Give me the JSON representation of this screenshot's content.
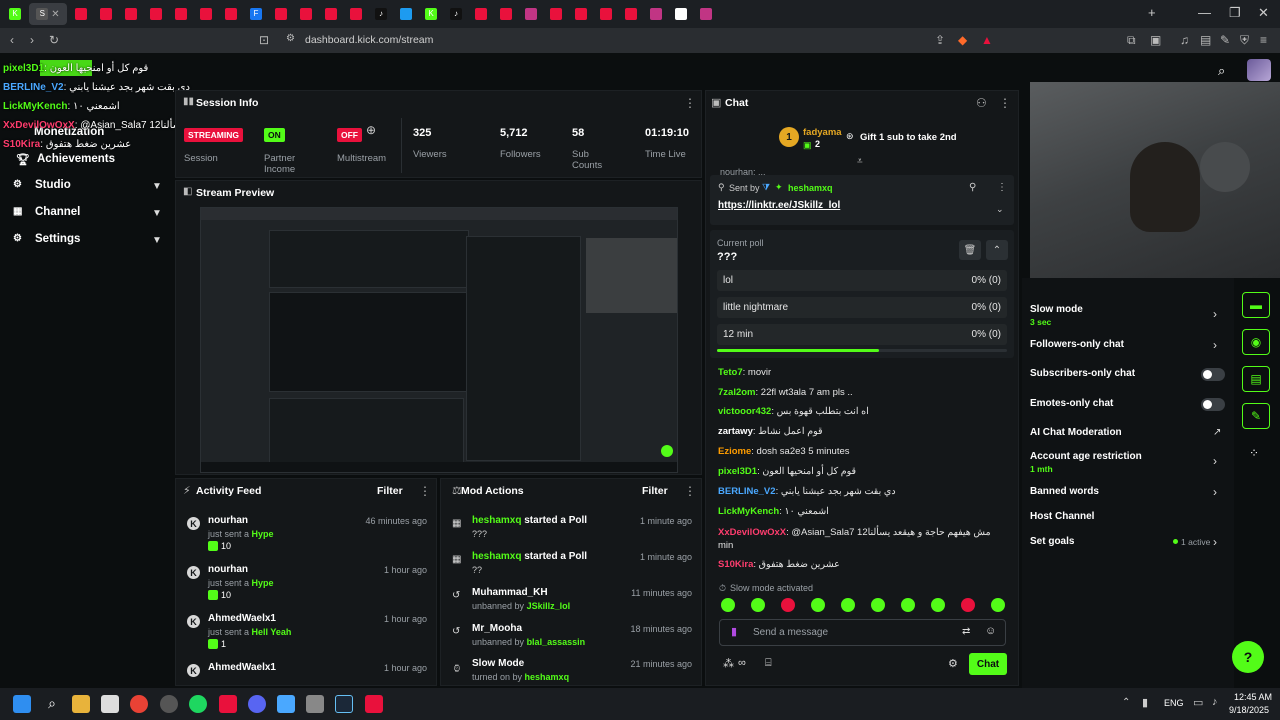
{
  "browser": {
    "url": "dashboard.kick.com/stream",
    "tabs": [
      {
        "fav": "#53fc18",
        "t": "K"
      },
      {
        "fav": "#e9113c",
        "t": ""
      },
      {
        "fav": "#e9113c",
        "t": ""
      },
      {
        "fav": "#e9113c",
        "t": ""
      },
      {
        "fav": "#e9113c",
        "t": ""
      },
      {
        "fav": "#e9113c",
        "t": ""
      },
      {
        "fav": "#e9113c",
        "t": ""
      },
      {
        "fav": "#e9113c",
        "t": ""
      },
      {
        "fav": "#e9113c",
        "t": ""
      },
      {
        "fav": "#1877f2",
        "t": "F"
      },
      {
        "fav": "#e9113c",
        "t": ""
      },
      {
        "fav": "#e9113c",
        "t": ""
      },
      {
        "fav": "#e9113c",
        "t": ""
      },
      {
        "fav": "#e9113c",
        "t": ""
      },
      {
        "fav": "#111",
        "t": "♪"
      },
      {
        "fav": "#1d9bf0",
        "t": ""
      },
      {
        "fav": "#53fc18",
        "t": "K"
      },
      {
        "fav": "#111",
        "t": "♪"
      },
      {
        "fav": "#e9113c",
        "t": ""
      },
      {
        "fav": "#e9113c",
        "t": ""
      },
      {
        "fav": "#c13584",
        "t": ""
      },
      {
        "fav": "#e9113c",
        "t": ""
      },
      {
        "fav": "#e9113c",
        "t": ""
      },
      {
        "fav": "#e9113c",
        "t": ""
      },
      {
        "fav": "#e9113c",
        "t": ""
      },
      {
        "fav": "#c13584",
        "t": ""
      },
      {
        "fav": "#fff",
        "t": "G"
      },
      {
        "fav": "#c13584",
        "t": ""
      }
    ],
    "selected_tab_letter": "S",
    "tab_letter_r": "r",
    "new_tab": "+",
    "minimize": "—",
    "maximize": "❐",
    "close": "✕"
  },
  "sidebar": {
    "items": [
      {
        "label": "Monetization"
      },
      {
        "label": "Achievements"
      },
      {
        "label": "Studio"
      },
      {
        "label": "Channel"
      },
      {
        "label": "Settings"
      }
    ]
  },
  "overlay_chat": [
    {
      "user": "pixel3D1",
      "text": "قوم كل أو امنحيها العون"
    },
    {
      "user": "BERLINe_V2",
      "text": "دي بقت شهر بجد عيشنا يابني"
    },
    {
      "user": "LickMyKench",
      "text": "اشمعني ١٠"
    },
    {
      "user": "XxDevilOwOxX",
      "text": "@Asian_Sala7 12مش هيفهم حاجة و هيقعد يسألنا min"
    },
    {
      "user": "S10Kira",
      "text": "عشرين ضغط هتفوق"
    }
  ],
  "session_info": {
    "title": "Session Info",
    "stats": [
      {
        "value": "STREAMING",
        "label": "Session"
      },
      {
        "value": "ON",
        "label": "Partner Income"
      },
      {
        "value": "OFF",
        "label": "Multistream"
      },
      {
        "value": "325",
        "label": "Viewers"
      },
      {
        "value": "5,712",
        "label": "Followers"
      },
      {
        "value": "58",
        "label": "Sub Counts"
      },
      {
        "value": "01:19:10",
        "label": "Time Live"
      }
    ]
  },
  "stream_preview": {
    "title": "Stream Preview"
  },
  "activity_feed": {
    "title": "Activity Feed",
    "filter": "Filter",
    "items": [
      {
        "name": "nourhan",
        "action": "just sent a",
        "gift": "Hype",
        "amount": "10",
        "time": "46 minutes ago"
      },
      {
        "name": "nourhan",
        "action": "just sent a",
        "gift": "Hype",
        "amount": "10",
        "time": "1 hour ago"
      },
      {
        "name": "AhmedWaelx1",
        "action": "just sent a",
        "gift": "Hell Yeah",
        "amount": "1",
        "time": "1 hour ago"
      },
      {
        "name": "AhmedWaelx1",
        "action": "",
        "gift": "",
        "amount": "",
        "time": "1 hour ago"
      }
    ]
  },
  "mod_actions": {
    "title": "Mod Actions",
    "filter": "Filter",
    "items": [
      {
        "name": "heshamxq",
        "action": "started a Poll",
        "detail": "???",
        "time": "1 minute ago"
      },
      {
        "name": "heshamxq",
        "action": "started a Poll",
        "detail": "??",
        "time": "1 minute ago"
      },
      {
        "name": "Muhammad_KH",
        "action": "",
        "detail": "unbanned by JSkillz_lol",
        "time": "11 minutes ago"
      },
      {
        "name": "Mr_Mooha",
        "action": "",
        "detail": "unbanned by blal_assassin",
        "time": "18 minutes ago"
      },
      {
        "name": "Slow Mode",
        "action": "",
        "detail": "turned on by heshamxq",
        "time": "21 minutes ago"
      }
    ]
  },
  "chat": {
    "title": "Chat",
    "gifter": "fadyama",
    "gifter_rank": "1",
    "gifter_count": "2",
    "gift_text": "Gift 1 sub to take 2nd",
    "pinned_partial": "nourhan: ...",
    "sent_by_label": "Sent by",
    "sent_by_user": "heshamxq",
    "pinned_link": "https://linktr.ee/JSkillz_lol",
    "poll": {
      "label": "Current poll",
      "question": "???",
      "options": [
        {
          "text": "lol",
          "result": "0% (0)"
        },
        {
          "text": "little nightmare",
          "result": "0% (0)"
        },
        {
          "text": "12 min",
          "result": "0% (0)"
        }
      ],
      "progress": 0.56
    },
    "messages": [
      {
        "user": "Teto7",
        "color": "#53fc18",
        "text": "movir"
      },
      {
        "user": "7zal2om",
        "color": "#53fc18",
        "text": "22fl wt3ala 7 am pls .."
      },
      {
        "user": "victooor432",
        "color": "#53fc18",
        "text": "اه انت بتطلب قهوة بس"
      },
      {
        "user": "zartawy",
        "color": "#ffffff",
        "text": "قوم اعمل نشاط"
      },
      {
        "user": "Eziome",
        "color": "#ff9d00",
        "text": "dosh sa2e3 5 minutes"
      },
      {
        "user": "pixel3D1",
        "color": "#53fc18",
        "text": "قوم كل أو امنحيها العون"
      },
      {
        "user": "BERLINe_V2",
        "color": "#4aa8ff",
        "text": "دي بقت شهر بجد عيشنا يابني"
      },
      {
        "user": "LickMyKench",
        "color": "#53fc18",
        "text": "اشمعني ١٠"
      },
      {
        "user": "XxDevilOwOxX",
        "color": "#ff3d6e",
        "text": "@Asian_Sala7 12مش هيفهم حاجة و هيقعد يسألنا min"
      },
      {
        "user": "S10Kira",
        "color": "#ff3d6e",
        "text": "عشرين ضغط هتفوق"
      }
    ],
    "slow_mode_notice": "Slow mode activated",
    "input_placeholder": "Send a message",
    "send_label": "Chat"
  },
  "chat_settings": {
    "items": [
      {
        "label": "Slow mode",
        "sub": "3 sec",
        "control": "chevron"
      },
      {
        "label": "Followers-only chat",
        "sub": "",
        "control": "chevron"
      },
      {
        "label": "Subscribers-only chat",
        "sub": "",
        "control": "toggle"
      },
      {
        "label": "Emotes-only chat",
        "sub": "",
        "control": "toggle"
      },
      {
        "label": "AI Chat Moderation",
        "sub": "",
        "control": "external"
      },
      {
        "label": "Account age restriction",
        "sub": "1 mth",
        "control": "chevron"
      },
      {
        "label": "Banned words",
        "sub": "",
        "control": "chevron"
      },
      {
        "label": "Host Channel",
        "sub": "",
        "control": "none"
      },
      {
        "label": "Set goals",
        "sub": "",
        "status": "1 active",
        "control": "chevron"
      }
    ]
  },
  "taskbar": {
    "lang": "ENG",
    "time": "12:45 AM",
    "date": "9/18/2025"
  },
  "colors": {
    "accent": "#53fc18",
    "live": "#e9113c"
  }
}
